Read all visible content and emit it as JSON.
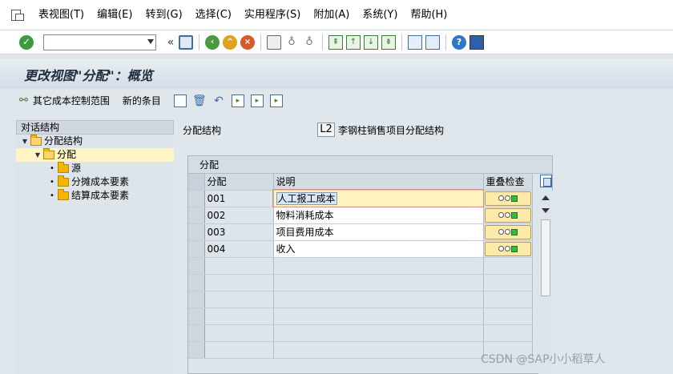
{
  "menu": [
    "表视图(T)",
    "编辑(E)",
    "转到(G)",
    "选择(C)",
    "实用程序(S)",
    "附加(A)",
    "系统(Y)",
    "帮助(H)"
  ],
  "toolbar": {
    "command_value": "",
    "chevron": "«"
  },
  "title": "更改视图\"分配\"：概览",
  "app_toolbar": {
    "other_scope": "其它成本控制范围",
    "new_entries": "新的条目"
  },
  "tree": {
    "header": "对话结构",
    "nodes": [
      {
        "label": "分配结构",
        "level": 0,
        "expanded": true
      },
      {
        "label": "分配",
        "level": 1,
        "expanded": true,
        "selected": true
      },
      {
        "label": "源",
        "level": 2
      },
      {
        "label": "分摊成本要素",
        "level": 2
      },
      {
        "label": "结算成本要素",
        "level": 2
      }
    ]
  },
  "header": {
    "label": "分配结构",
    "code": "L2",
    "description": "李钢柱销售项目分配结构"
  },
  "table": {
    "title": "分配",
    "columns": [
      "分配",
      "说明",
      "重叠检查"
    ],
    "rows": [
      {
        "id": "001",
        "desc": "人工报工成本"
      },
      {
        "id": "002",
        "desc": "物料消耗成本"
      },
      {
        "id": "003",
        "desc": "项目费用成本"
      },
      {
        "id": "004",
        "desc": "收入"
      }
    ]
  },
  "watermark": "CSDN @SAP小小稻草人"
}
